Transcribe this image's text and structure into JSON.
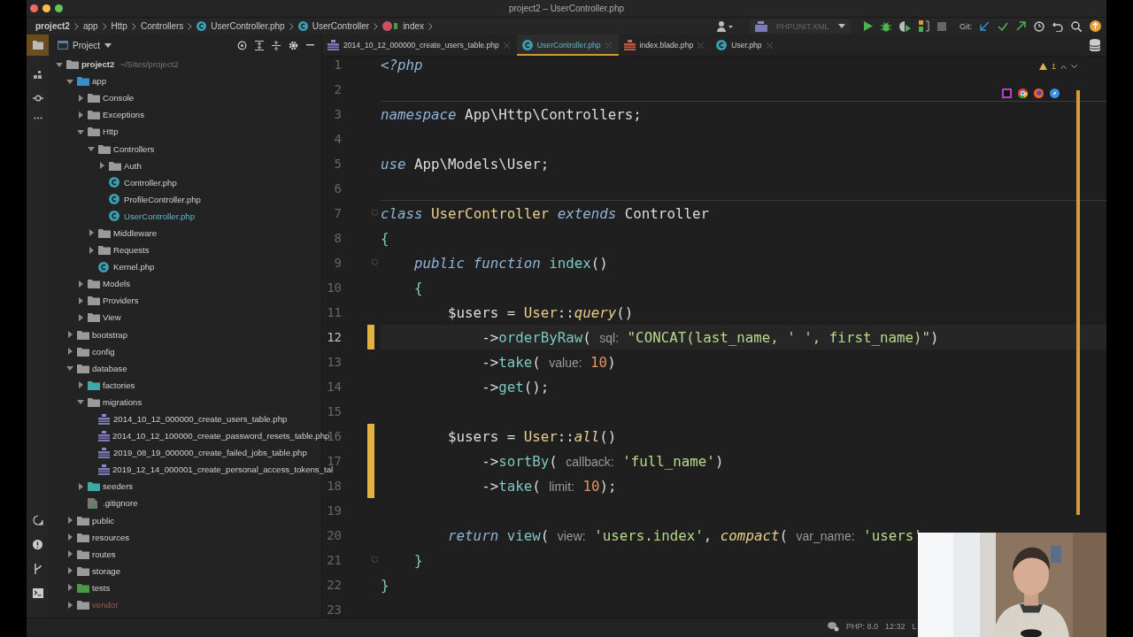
{
  "window": {
    "title": "project2 – UserController.php"
  },
  "breadcrumbs": [
    {
      "kind": "project",
      "label": "project2"
    },
    {
      "kind": "folder",
      "label": "app"
    },
    {
      "kind": "folder",
      "label": "Http"
    },
    {
      "kind": "folder",
      "label": "Controllers"
    },
    {
      "kind": "file",
      "label": "UserController.php"
    },
    {
      "kind": "class",
      "label": "UserController"
    },
    {
      "kind": "method",
      "label": "index"
    }
  ],
  "toolbar": {
    "run_config": "PHPUNIT.XML",
    "git_label": "Git:"
  },
  "project_panel": {
    "title": "Project",
    "tree": [
      {
        "kind": "folder",
        "label": "project2",
        "path": "~/Sites/project2",
        "color": "#9a9a9a",
        "expanded": true,
        "children": [
          {
            "kind": "folder",
            "label": "app",
            "color": "#3a8dc8",
            "expanded": true,
            "children": [
              {
                "kind": "folder",
                "label": "Console",
                "color": "#9a9a9a",
                "expanded": false
              },
              {
                "kind": "folder",
                "label": "Exceptions",
                "color": "#9a9a9a",
                "expanded": false
              },
              {
                "kind": "folder",
                "label": "Http",
                "color": "#9a9a9a",
                "expanded": true,
                "children": [
                  {
                    "kind": "folder",
                    "label": "Controllers",
                    "color": "#9a9a9a",
                    "expanded": true,
                    "children": [
                      {
                        "kind": "folder",
                        "label": "Auth",
                        "color": "#9a9a9a",
                        "expanded": false
                      },
                      {
                        "kind": "php",
                        "label": "Controller.php"
                      },
                      {
                        "kind": "php",
                        "label": "ProfileController.php"
                      },
                      {
                        "kind": "php",
                        "label": "UserController.php",
                        "open": true
                      }
                    ]
                  },
                  {
                    "kind": "folder",
                    "label": "Middleware",
                    "color": "#9a9a9a",
                    "expanded": false
                  },
                  {
                    "kind": "folder",
                    "label": "Requests",
                    "color": "#9a9a9a",
                    "expanded": false
                  },
                  {
                    "kind": "php",
                    "label": "Kernel.php"
                  }
                ]
              },
              {
                "kind": "folder",
                "label": "Models",
                "color": "#9a9a9a",
                "expanded": false
              },
              {
                "kind": "folder",
                "label": "Providers",
                "color": "#9a9a9a",
                "expanded": false
              },
              {
                "kind": "folder",
                "label": "View",
                "color": "#9a9a9a",
                "expanded": false
              }
            ]
          },
          {
            "kind": "folder",
            "label": "bootstrap",
            "color": "#9a9a9a",
            "expanded": false
          },
          {
            "kind": "folder",
            "label": "config",
            "color": "#9a9a9a",
            "expanded": false
          },
          {
            "kind": "folder",
            "label": "database",
            "color": "#9a9a9a",
            "expanded": true,
            "children": [
              {
                "kind": "folder",
                "label": "factories",
                "color": "#3fa7a7",
                "expanded": false
              },
              {
                "kind": "folder",
                "label": "migrations",
                "color": "#9a9a9a",
                "expanded": true,
                "children": [
                  {
                    "kind": "migration",
                    "label": "2014_10_12_000000_create_users_table.php"
                  },
                  {
                    "kind": "migration",
                    "label": "2014_10_12_100000_create_password_resets_table.php"
                  },
                  {
                    "kind": "migration",
                    "label": "2019_08_19_000000_create_failed_jobs_table.php"
                  },
                  {
                    "kind": "migration",
                    "label": "2019_12_14_000001_create_personal_access_tokens_tal"
                  }
                ]
              },
              {
                "kind": "folder",
                "label": "seeders",
                "color": "#3fa7a7",
                "expanded": false
              },
              {
                "kind": "ignore",
                "label": ".gitignore"
              }
            ]
          },
          {
            "kind": "folder",
            "label": "public",
            "color": "#9a9a9a",
            "expanded": false
          },
          {
            "kind": "folder",
            "label": "resources",
            "color": "#9a9a9a",
            "expanded": false
          },
          {
            "kind": "folder",
            "label": "routes",
            "color": "#9a9a9a",
            "expanded": false
          },
          {
            "kind": "folder",
            "label": "storage",
            "color": "#9a9a9a",
            "expanded": false
          },
          {
            "kind": "folder",
            "label": "tests",
            "color": "#4a9a3f",
            "expanded": false
          },
          {
            "kind": "folder",
            "label": "vendor",
            "color": "#9a9a9a",
            "expanded": false,
            "excluded": true
          }
        ]
      }
    ]
  },
  "tabs": [
    {
      "kind": "migration",
      "label": "2014_10_12_000000_create_users_table.php",
      "selected": false
    },
    {
      "kind": "class",
      "label": "UserController.php",
      "selected": true
    },
    {
      "kind": "blade",
      "label": "index.blade.php",
      "selected": false
    },
    {
      "kind": "class",
      "label": "User.php",
      "selected": false
    }
  ],
  "editor": {
    "warnings": "1",
    "lines": [
      {
        "number": "1",
        "tokens": [
          {
            "kind": "kw",
            "text": "<?php"
          }
        ]
      },
      {
        "number": "2",
        "separator": true
      },
      {
        "number": "3",
        "tokens": [
          {
            "kind": "kw",
            "text": "namespace"
          },
          {
            "kind": "plain",
            "text": " App\\Http\\Controllers;"
          }
        ]
      },
      {
        "number": "4"
      },
      {
        "number": "5",
        "tokens": [
          {
            "kind": "kw",
            "text": "use"
          },
          {
            "kind": "plain",
            "text": " App\\Models\\User;"
          }
        ]
      },
      {
        "number": "6",
        "separator": true
      },
      {
        "number": "7",
        "tokens": [
          {
            "kind": "kw",
            "text": "class"
          },
          {
            "kind": "cls",
            "text": " UserController "
          },
          {
            "kind": "kw",
            "text": "extends"
          },
          {
            "kind": "plain",
            "text": " Controller"
          }
        ],
        "fold": true
      },
      {
        "number": "8",
        "tokens": [
          {
            "kind": "brace",
            "text": "{"
          }
        ]
      },
      {
        "number": "9",
        "tokens": [
          {
            "kind": "kw",
            "text": "    public function"
          },
          {
            "kind": "fn",
            "text": " index"
          },
          {
            "kind": "plain",
            "text": "()"
          }
        ],
        "fold": true
      },
      {
        "number": "10",
        "tokens": [
          {
            "kind": "brace",
            "text": "    {"
          }
        ]
      },
      {
        "number": "11",
        "tokens": [
          {
            "kind": "plain",
            "text": "        $users = "
          },
          {
            "kind": "cls",
            "text": "User"
          },
          {
            "kind": "plain",
            "text": "::"
          },
          {
            "kind": "static",
            "text": "query"
          },
          {
            "kind": "plain",
            "text": "()"
          }
        ]
      },
      {
        "number": "12",
        "tokens": [
          {
            "kind": "plain",
            "text": "            ->"
          },
          {
            "kind": "fn",
            "text": "orderByRaw"
          },
          {
            "kind": "plain",
            "text": "( "
          },
          {
            "kind": "hint",
            "text": "sql:"
          },
          {
            "kind": "str",
            "text": " \"CONCAT(last_name, ' ', first_name)\""
          },
          {
            "kind": "plain",
            "text": ")"
          }
        ],
        "changed": true,
        "current": true
      },
      {
        "number": "13",
        "tokens": [
          {
            "kind": "plain",
            "text": "            ->"
          },
          {
            "kind": "fn",
            "text": "take"
          },
          {
            "kind": "plain",
            "text": "( "
          },
          {
            "kind": "hint",
            "text": "value:"
          },
          {
            "kind": "num",
            "text": " 10"
          },
          {
            "kind": "plain",
            "text": ")"
          }
        ]
      },
      {
        "number": "14",
        "tokens": [
          {
            "kind": "plain",
            "text": "            ->"
          },
          {
            "kind": "fn",
            "text": "get"
          },
          {
            "kind": "plain",
            "text": "();"
          }
        ]
      },
      {
        "number": "15"
      },
      {
        "number": "16",
        "tokens": [
          {
            "kind": "plain",
            "text": "        $users = "
          },
          {
            "kind": "cls",
            "text": "User"
          },
          {
            "kind": "plain",
            "text": "::"
          },
          {
            "kind": "static",
            "text": "all"
          },
          {
            "kind": "plain",
            "text": "()"
          }
        ],
        "changed": true
      },
      {
        "number": "17",
        "tokens": [
          {
            "kind": "plain",
            "text": "            ->"
          },
          {
            "kind": "fn",
            "text": "sortBy"
          },
          {
            "kind": "plain",
            "text": "( "
          },
          {
            "kind": "hint",
            "text": "callback:"
          },
          {
            "kind": "str",
            "text": " 'full_name'"
          },
          {
            "kind": "plain",
            "text": ")"
          }
        ],
        "changed": true
      },
      {
        "number": "18",
        "tokens": [
          {
            "kind": "plain",
            "text": "            ->"
          },
          {
            "kind": "fn",
            "text": "take"
          },
          {
            "kind": "plain",
            "text": "( "
          },
          {
            "kind": "hint",
            "text": "limit:"
          },
          {
            "kind": "num",
            "text": " 10"
          },
          {
            "kind": "plain",
            "text": ");"
          }
        ],
        "changed": true
      },
      {
        "number": "19"
      },
      {
        "number": "20",
        "tokens": [
          {
            "kind": "kw",
            "text": "        return"
          },
          {
            "kind": "fn",
            "text": " view"
          },
          {
            "kind": "plain",
            "text": "( "
          },
          {
            "kind": "hint",
            "text": "view:"
          },
          {
            "kind": "str",
            "text": " 'users.index'"
          },
          {
            "kind": "plain",
            "text": ", "
          },
          {
            "kind": "static",
            "text": "compact"
          },
          {
            "kind": "plain",
            "text": "( "
          },
          {
            "kind": "hint",
            "text": "var_name:"
          },
          {
            "kind": "str",
            "text": " 'users'"
          }
        ]
      },
      {
        "number": "21",
        "tokens": [
          {
            "kind": "brace",
            "text": "    }"
          }
        ],
        "fold": true
      },
      {
        "number": "22",
        "tokens": [
          {
            "kind": "brace",
            "text": "}"
          }
        ]
      },
      {
        "number": "23"
      }
    ]
  },
  "status_bar": {
    "php": "PHP: 8.0",
    "position": "12:32",
    "line_separator": "L"
  }
}
